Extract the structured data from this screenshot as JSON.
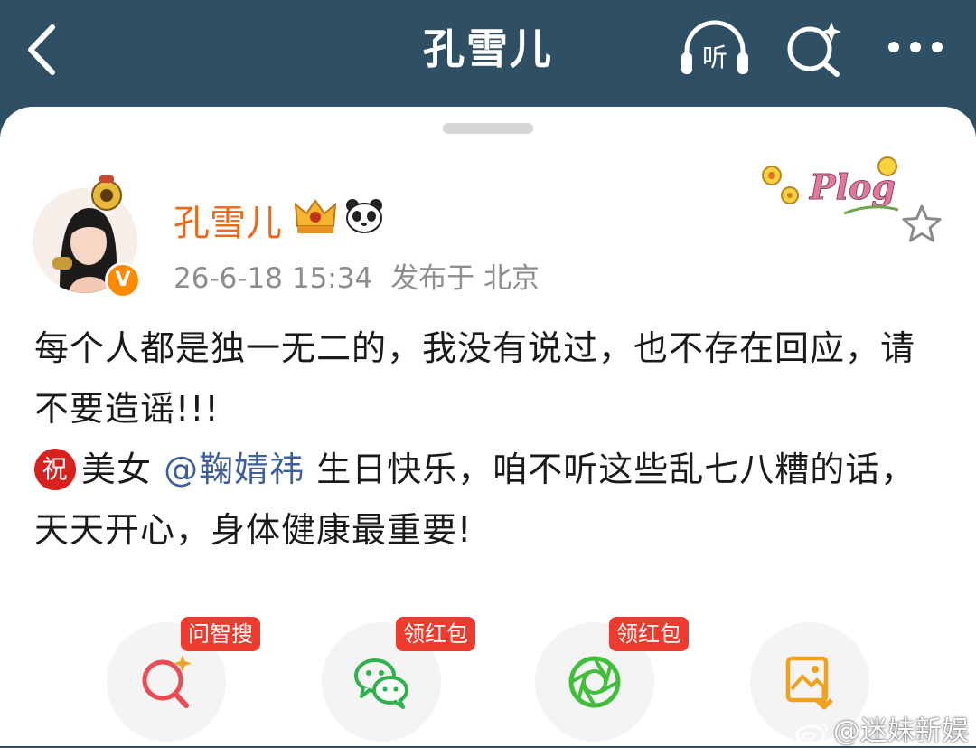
{
  "header": {
    "title": "孔雪儿",
    "listen_label": "听",
    "icons": [
      "back-arrow-icon",
      "listen-headphones-icon",
      "search-sparkle-icon",
      "more-dots-icon"
    ]
  },
  "post": {
    "author": {
      "name": "孔雪儿",
      "verified_mark": "V",
      "badges": [
        "crown-icon",
        "panda-icon"
      ]
    },
    "time": "26-6-18 15:34",
    "location": "发布于 北京",
    "sticker_text": "Plog",
    "text_line1": "每个人都是独一无二的，我没有说过，也不存在回应，请不要造谣!!!",
    "congrats_char": "祝",
    "text_before_mention": "美女 ",
    "mention": "@鞠婧祎",
    "text_after_mention": " 生日快乐，咱不听这些乱七八糟的话，天天开心，身体健康最重要!"
  },
  "actions": [
    {
      "icon": "ask-search-icon",
      "badge": "问智搜"
    },
    {
      "icon": "wechat-icon",
      "badge": "领红包"
    },
    {
      "icon": "moments-icon",
      "badge": "领红包"
    },
    {
      "icon": "save-image-icon",
      "badge": ""
    }
  ],
  "watermark": "@迷妹新娱",
  "colors": {
    "header_bg": "#2f5064",
    "author_name": "#e86a1a",
    "mention": "#3d5f9b",
    "badge_red": "#ef3b2d"
  }
}
